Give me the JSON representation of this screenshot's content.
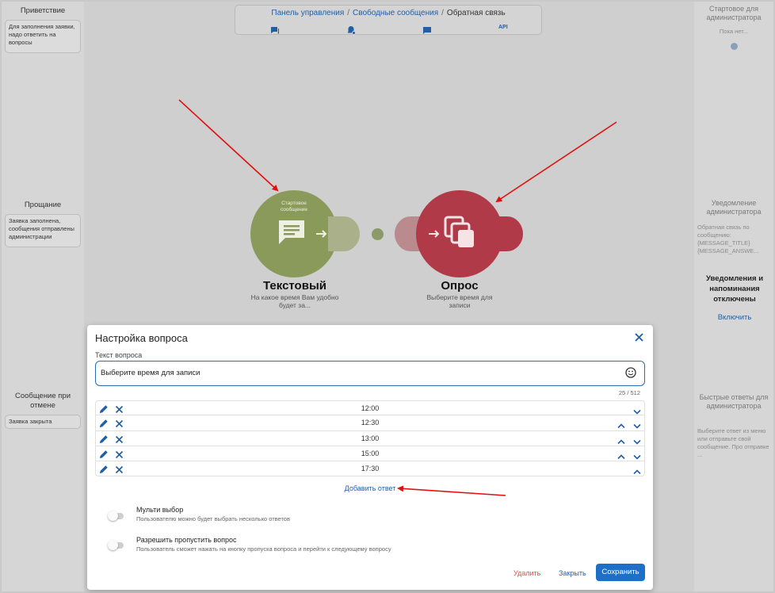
{
  "left_panel": {
    "greeting": {
      "title": "Приветствие",
      "note": "Для заполнения заявки, надо ответить на вопросы"
    },
    "farewell": {
      "title": "Прощание",
      "note": "Заявка заполнена, сообщения отправлены администрации"
    },
    "cancel": {
      "title": "Сообщение при отмене",
      "note": "Заявка закрыта"
    }
  },
  "right_panel": {
    "start_admin": {
      "title": "Стартовое для администратора",
      "note": "Пока нет..."
    },
    "admin_notify": {
      "title": "Уведомление администратора",
      "note": "Обратная связь по сообщению: {MESSAGE_TITLE} {MESSAGE_ANSWE..."
    },
    "reminders": {
      "text": "Уведомления и напоминания отключены",
      "link": "Включить"
    },
    "quick_replies": {
      "title": "Быстрые ответы для администратора",
      "note": "Выберите ответ из меню или отправьте свой сообщение. Про отправке ..."
    }
  },
  "breadcrumb": {
    "items": [
      "Панель управления",
      "Свободные сообщения",
      "Обратная связь"
    ],
    "separator": "/",
    "icons": [
      "chat-icon",
      "bell-settings-icon",
      "message-icon",
      "api-icon"
    ],
    "api_label": "API"
  },
  "flow": {
    "node1": {
      "badge": "Стартовое сообщение",
      "title": "Текстовый",
      "subtitle": "На какое время Вам удобно будет за..."
    },
    "node2": {
      "title": "Опрос",
      "subtitle": "Выберите время для записи"
    },
    "colors": {
      "green": "#8a9a5b",
      "red": "#b03a48"
    }
  },
  "dialog": {
    "title": "Настройка вопроса",
    "question_label": "Текст вопроса",
    "question_value": "Выберите время для записи",
    "counter": "25 / 512",
    "answers": [
      "12:00",
      "12:30",
      "13:00",
      "15:00",
      "17:30"
    ],
    "add_answer": "Добавить ответ",
    "multi_select": {
      "title": "Мульти выбор",
      "desc": "Пользователю можно будет выбрать несколько ответов"
    },
    "allow_skip": {
      "title": "Разрешить пропустить вопрос",
      "desc": "Пользователь сможет нажать на кнопку пропуска вопроса и перейти к следующему вопросу"
    },
    "buttons": {
      "delete": "Удалить",
      "close": "Закрыть",
      "save": "Сохранить"
    },
    "colors": {
      "accent": "#1e6fc7",
      "danger": "#d9534f"
    }
  }
}
